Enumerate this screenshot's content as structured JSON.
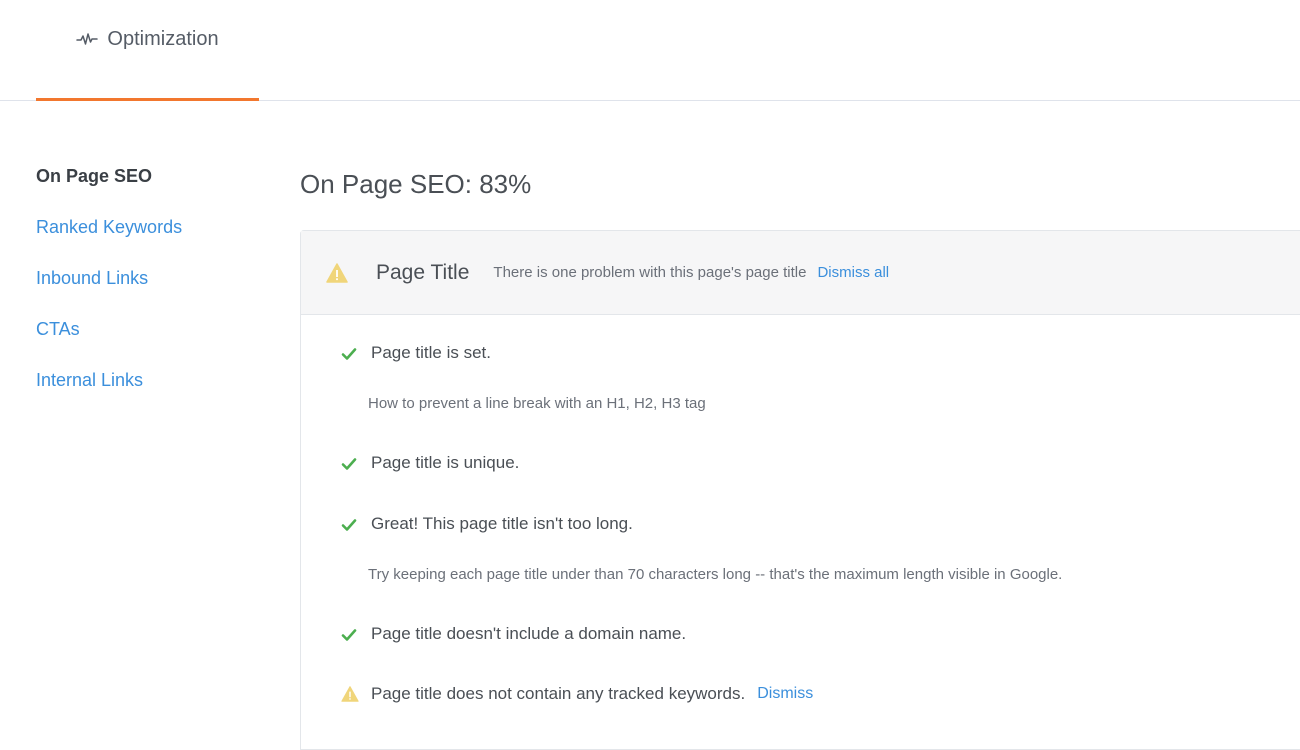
{
  "tabs": [
    {
      "label": "Optimization",
      "icon": "activity-pulse-icon",
      "active": true
    }
  ],
  "colors": {
    "accent": "#f2772e",
    "link": "#3b8fdc",
    "success": "#4cae4f",
    "warning": "#f0d57a"
  },
  "sidebar": {
    "items": [
      {
        "label": "On Page SEO",
        "active": true
      },
      {
        "label": "Ranked Keywords",
        "active": false
      },
      {
        "label": "Inbound Links",
        "active": false
      },
      {
        "label": "CTAs",
        "active": false
      },
      {
        "label": "Internal Links",
        "active": false
      }
    ]
  },
  "main": {
    "title": "On Page SEO: 83%",
    "section": {
      "icon": "warning-icon",
      "title": "Page Title",
      "summary": "There is one problem with this page's page title",
      "dismiss_all_label": "Dismiss all",
      "checks": [
        {
          "status": "pass",
          "icon": "check-icon",
          "text": "Page title is set.",
          "hint": "How to prevent a line break with an H1, H2, H3 tag"
        },
        {
          "status": "pass",
          "icon": "check-icon",
          "text": "Page title is unique.",
          "hint": null
        },
        {
          "status": "pass",
          "icon": "check-icon",
          "text": "Great! This page title isn't too long.",
          "hint": "Try keeping each page title under than 70 characters long -- that's the maximum length visible in Google."
        },
        {
          "status": "pass",
          "icon": "check-icon",
          "text": "Page title doesn't include a domain name.",
          "hint": null
        },
        {
          "status": "warning",
          "icon": "warning-icon",
          "text": "Page title does not contain any tracked keywords.",
          "hint": null,
          "dismiss_label": "Dismiss"
        }
      ]
    }
  }
}
